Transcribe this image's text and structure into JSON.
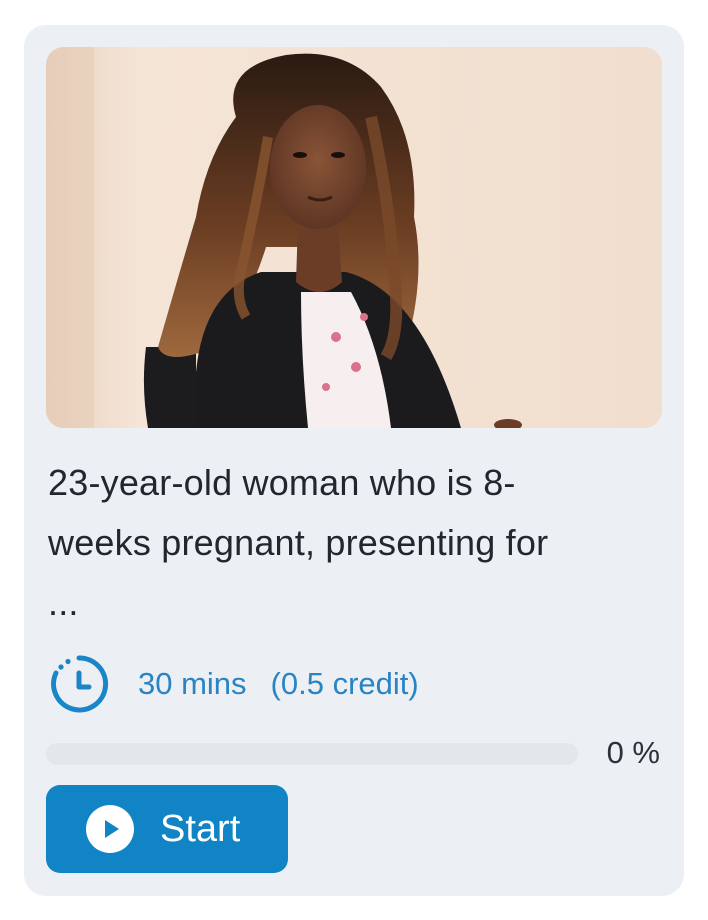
{
  "case_card": {
    "title_line1": "23-year-old woman who is 8-",
    "title_line2": "weeks pregnant, presenting for",
    "title_ellipsis": "...",
    "image_icon": "patient-photo",
    "duration": "30 mins",
    "credit": "(0.5 credit)",
    "duration_icon": "clock-icon",
    "progress_percent": 0,
    "progress_label": "0 %",
    "start_button": {
      "label": "Start",
      "icon": "play-icon"
    },
    "colors": {
      "accent": "#1184c6",
      "meta_text": "#2a84c4",
      "card_bg": "#eceff3"
    }
  }
}
